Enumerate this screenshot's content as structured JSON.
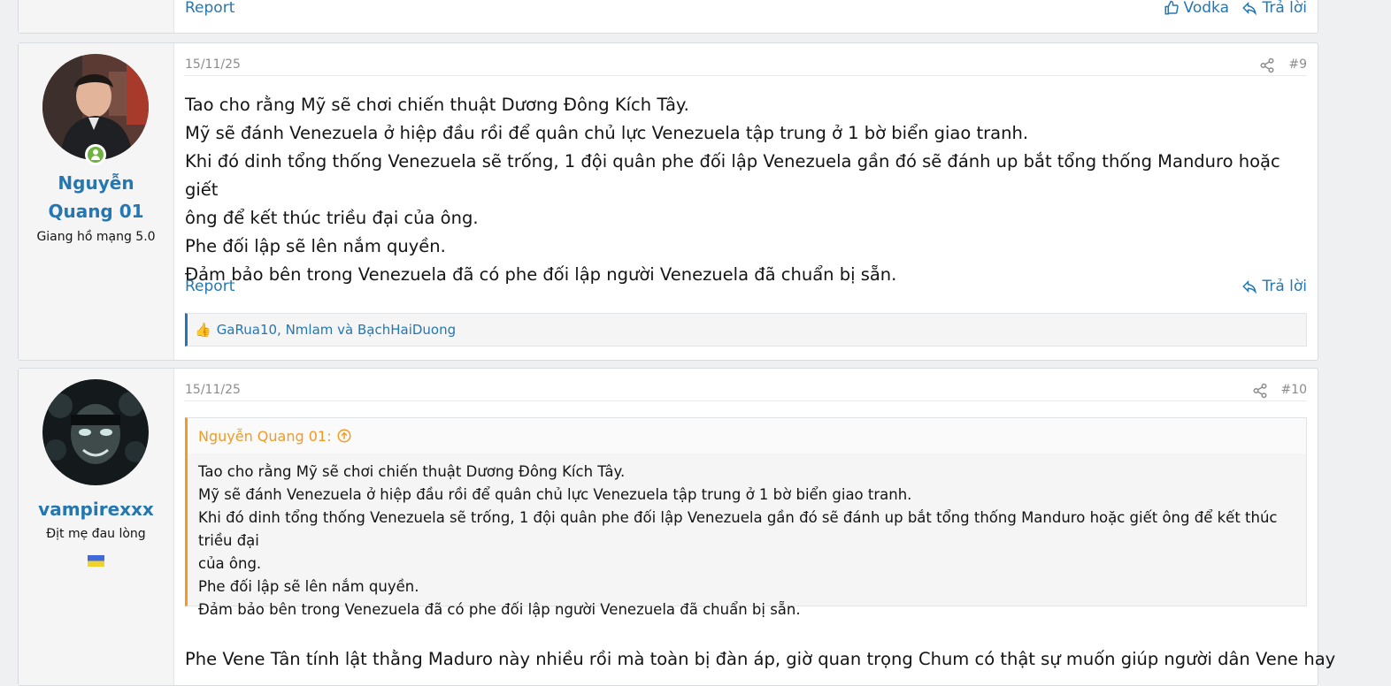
{
  "post_prev": {
    "report_label": "Report",
    "reaction_label": "Vodka",
    "reply_label": "Trả lời"
  },
  "post9": {
    "username_line1": "Nguyễn",
    "username_line2": "Quang 01",
    "user_title": "Giang hồ mạng 5.0",
    "date": "15/11/25",
    "post_number": "#9",
    "body": [
      "Tao cho rằng Mỹ sẽ chơi chiến thuật Dương Đông Kích Tây.",
      "Mỹ sẽ đánh Venezuela ở hiệp đầu rồi để quân chủ lực Venezuela tập trung ở 1 bờ biển giao tranh.",
      "Khi đó dinh tổng thống Venezuela sẽ trống, 1 đội quân phe đối lập Venezuela gần đó sẽ đánh up bắt tổng thống Manduro hoặc giết",
      "ông để kết thúc triều đại của ông.",
      "Phe đối lập sẽ lên nắm quyền.",
      "Đảm bảo bên trong Venezuela đã có phe đối lập người Venezuela đã chuẩn bị sẵn."
    ],
    "report_label": "Report",
    "reply_label": "Trả lời",
    "reactions_text": "GaRua10, Nmlam và BạchHaiDuong"
  },
  "post10": {
    "username": "vampirexxx",
    "user_title": "Địt mẹ đau lòng",
    "date": "15/11/25",
    "post_number": "#10",
    "quote_author": "Nguyễn Quang 01:",
    "quote_lines": [
      "Tao cho rằng Mỹ sẽ chơi chiến thuật Dương Đông Kích Tây.",
      "Mỹ sẽ đánh Venezuela ở hiệp đầu rồi để quân chủ lực Venezuela tập trung ở 1 bờ biển giao tranh.",
      "Khi đó dinh tổng thống Venezuela sẽ trống, 1 đội quân phe đối lập Venezuela gần đó sẽ đánh up bắt tổng thống Manduro hoặc giết ông để kết thúc triều đại",
      "của ông.",
      "Phe đối lập sẽ lên nắm quyền.",
      "Đảm bảo bên trong Venezuela đã có phe đối lập người Venezuela đã chuẩn bị sẵn."
    ],
    "body": "Phe Vene Tân tính lật thằng Maduro này nhiều rồi mà toàn bị đàn áp, giờ quan trọng Chum có thật sự muốn giúp người dân Vene hay"
  },
  "colors": {
    "link": "#2577b1",
    "quote_accent": "#f39a23",
    "online": "#6fb23f",
    "muted": "#8c8c8c"
  }
}
